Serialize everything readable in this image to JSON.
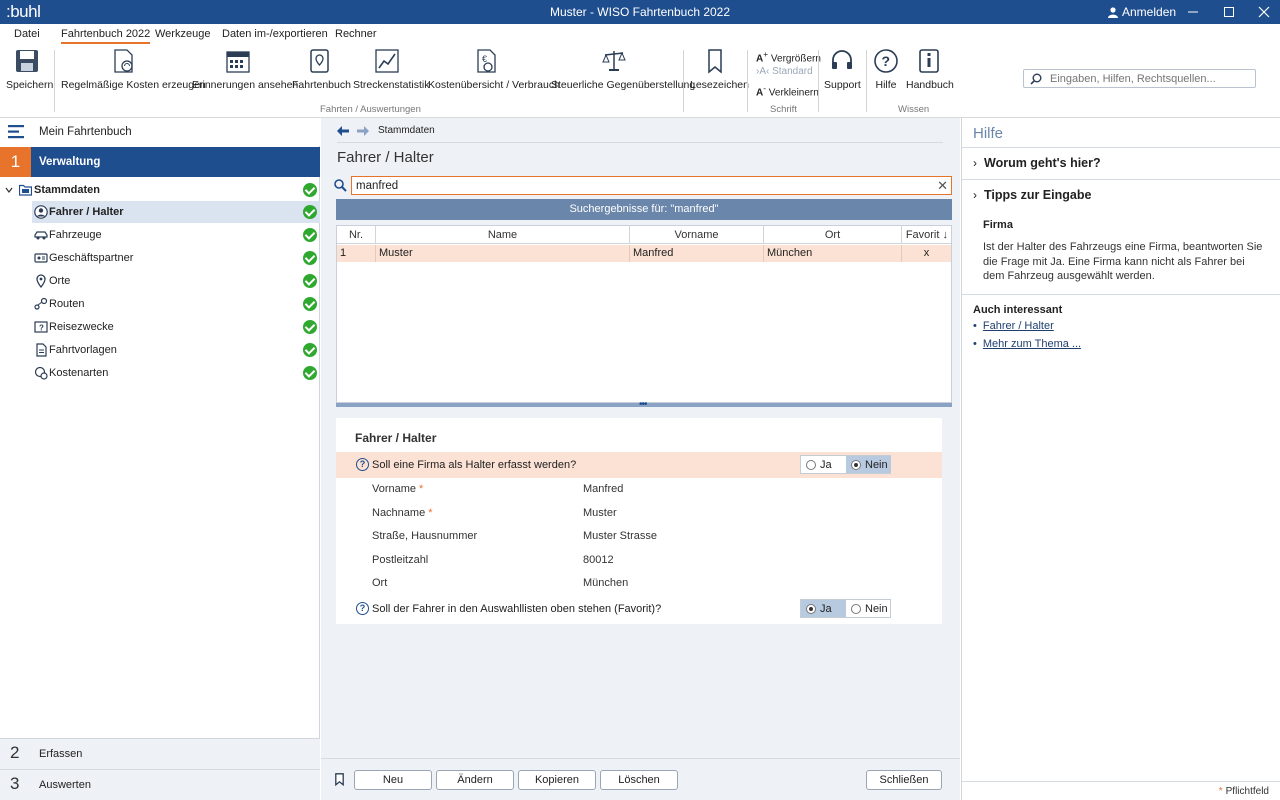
{
  "window": {
    "logo": ":buhl",
    "title": "Muster - WISO Fahrtenbuch 2022",
    "login_label": "Anmelden"
  },
  "menu": {
    "tabs": [
      "Datei",
      "Fahrtenbuch 2022",
      "Werkzeuge",
      "Daten im-/exportieren",
      "Rechner"
    ],
    "active_tab": "Fahrtenbuch 2022"
  },
  "ribbon": {
    "buttons": {
      "save": "Speichern",
      "recurring_costs": "Regelmäßige Kosten erzeugen",
      "reminders": "Erinnerungen ansehen",
      "logbook": "Fahrtenbuch",
      "route_stats": "Streckenstatistik",
      "cost_overview": "Kostenübersicht / Verbrauch",
      "tax_comparison": "Steuerliche Gegenüberstellung",
      "bookmarks": "Lesezeichen",
      "support": "Support",
      "help": "Hilfe",
      "manual": "Handbuch"
    },
    "font": {
      "enlarge": "Vergrößern",
      "standard": "Standard",
      "shrink": "Verkleinern"
    },
    "group_labels": {
      "trips": "Fahrten / Auswertungen",
      "font": "Schrift",
      "knowledge": "Wissen"
    },
    "search_placeholder": "Eingaben, Hilfen, Rechtsquellen..."
  },
  "nav": {
    "my_logbook": "Mein Fahrtenbuch",
    "section1": {
      "num": "1",
      "label": "Verwaltung"
    },
    "tree_root": "Stammdaten",
    "items": [
      {
        "label": "Fahrer / Halter",
        "icon": "person-icon",
        "selected": true,
        "done": true
      },
      {
        "label": "Fahrzeuge",
        "icon": "car-icon",
        "selected": false,
        "done": true
      },
      {
        "label": "Geschäftspartner",
        "icon": "partner-icon",
        "selected": false,
        "done": true
      },
      {
        "label": "Orte",
        "icon": "location-pin-icon",
        "selected": false,
        "done": true
      },
      {
        "label": "Routen",
        "icon": "route-icon",
        "selected": false,
        "done": true
      },
      {
        "label": "Reisezwecke",
        "icon": "purpose-icon",
        "selected": false,
        "done": true
      },
      {
        "label": "Fahrtvorlagen",
        "icon": "template-icon",
        "selected": false,
        "done": true
      },
      {
        "label": "Kostenarten",
        "icon": "cost-type-icon",
        "selected": false,
        "done": true
      }
    ],
    "section2": {
      "num": "2",
      "label": "Erfassen"
    },
    "section3": {
      "num": "3",
      "label": "Auswerten"
    }
  },
  "main": {
    "breadcrumb": "Stammdaten",
    "title": "Fahrer / Halter",
    "search_value": "manfred",
    "results_header": "Suchergebnisse für: \"manfred\"",
    "table": {
      "columns": [
        "Nr.",
        "Name",
        "Vorname",
        "Ort",
        "Favorit ↓"
      ],
      "rows": [
        [
          "1",
          "Muster",
          "Manfred",
          "München",
          "x"
        ]
      ]
    },
    "detail": {
      "title": "Fahrer / Halter",
      "company_question": "Soll eine Firma als Halter erfasst werden?",
      "company_options": [
        "Ja",
        "Nein"
      ],
      "company_selected": "Nein",
      "fields": [
        {
          "label": "Vorname",
          "required": true,
          "value": "Manfred"
        },
        {
          "label": "Nachname",
          "required": true,
          "value": "Muster"
        },
        {
          "label": "Straße, Hausnummer",
          "required": false,
          "value": "Muster Strasse"
        },
        {
          "label": "Postleitzahl",
          "required": false,
          "value": "80012"
        },
        {
          "label": "Ort",
          "required": false,
          "value": "München"
        }
      ],
      "required_mark": "*",
      "favorite_question": "Soll der Fahrer in den Auswahllisten oben stehen (Favorit)?",
      "favorite_options": [
        "Ja",
        "Nein"
      ],
      "favorite_selected": "Ja"
    },
    "buttons": {
      "new": "Neu",
      "edit": "Ändern",
      "copy": "Kopieren",
      "delete": "Löschen",
      "close": "Schließen"
    }
  },
  "help": {
    "title": "Hilfe",
    "section1": "Worum geht's hier?",
    "section2": "Tipps zur Eingabe",
    "topic": "Firma",
    "text": "Ist der Halter des Fahrzeugs eine Firma, beantworten Sie die Frage mit Ja. Eine Firma kann nicht als Fahrer bei dem Fahrzeug ausgewählt werden.",
    "also_interesting": "Auch interessant",
    "links": [
      "Fahrer / Halter",
      "Mehr zum Thema ..."
    ],
    "required_note": "Pflichtfeld",
    "required_mark": "*"
  },
  "colors": {
    "brand_blue": "#1f4e8f",
    "accent_orange": "#e8742c",
    "highlight_row": "#fbe2d4",
    "check_green": "#2fa82f"
  }
}
